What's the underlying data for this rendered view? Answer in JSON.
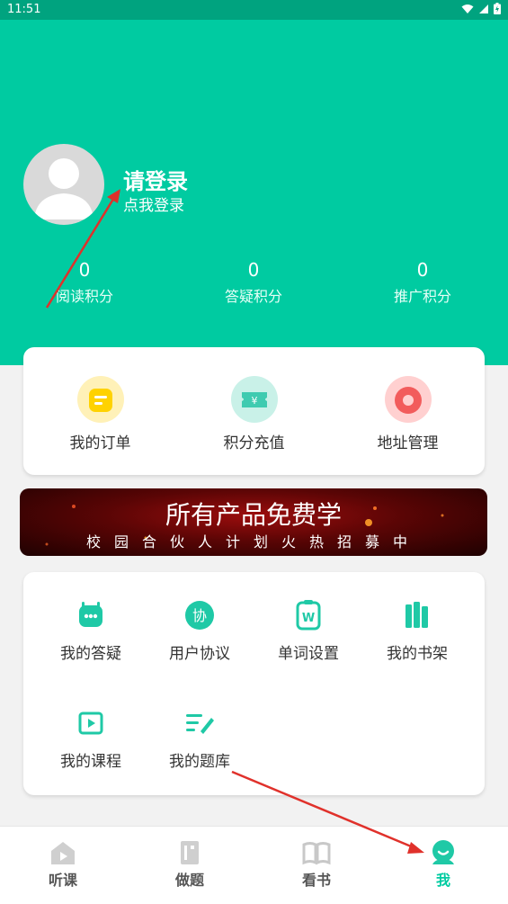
{
  "status": {
    "time": "11:51"
  },
  "profile": {
    "title": "请登录",
    "subtitle": "点我登录"
  },
  "stats": [
    {
      "value": "0",
      "label": "阅读积分"
    },
    {
      "value": "0",
      "label": "答疑积分"
    },
    {
      "value": "0",
      "label": "推广积分"
    }
  ],
  "quick": [
    {
      "label": "我的订单",
      "icon": "order-icon",
      "color": "#ffd200"
    },
    {
      "label": "积分充值",
      "icon": "points-recharge-icon",
      "color": "#3fcbb0"
    },
    {
      "label": "地址管理",
      "icon": "location-icon",
      "color": "#f25c5c"
    }
  ],
  "banner": {
    "title": "所有产品免费学",
    "subtitle": "校园合伙人计划火热招募中"
  },
  "menu": [
    {
      "label": "我的答疑",
      "icon": "chat-robot-icon"
    },
    {
      "label": "用户协议",
      "icon": "agreement-icon",
      "glyph": "协"
    },
    {
      "label": "单词设置",
      "icon": "word-settings-icon",
      "glyph": "W"
    },
    {
      "label": "我的书架",
      "icon": "bookshelf-icon"
    },
    {
      "label": "我的课程",
      "icon": "video-course-icon"
    },
    {
      "label": "我的题库",
      "icon": "question-bank-icon"
    }
  ],
  "tabs": [
    {
      "label": "听课",
      "icon": "play-house-icon"
    },
    {
      "label": "做题",
      "icon": "exercise-icon"
    },
    {
      "label": "看书",
      "icon": "book-icon"
    },
    {
      "label": "我",
      "icon": "me-icon",
      "active": true
    }
  ],
  "colors": {
    "primary": "#00cba1",
    "arrow": "#e0312b"
  }
}
